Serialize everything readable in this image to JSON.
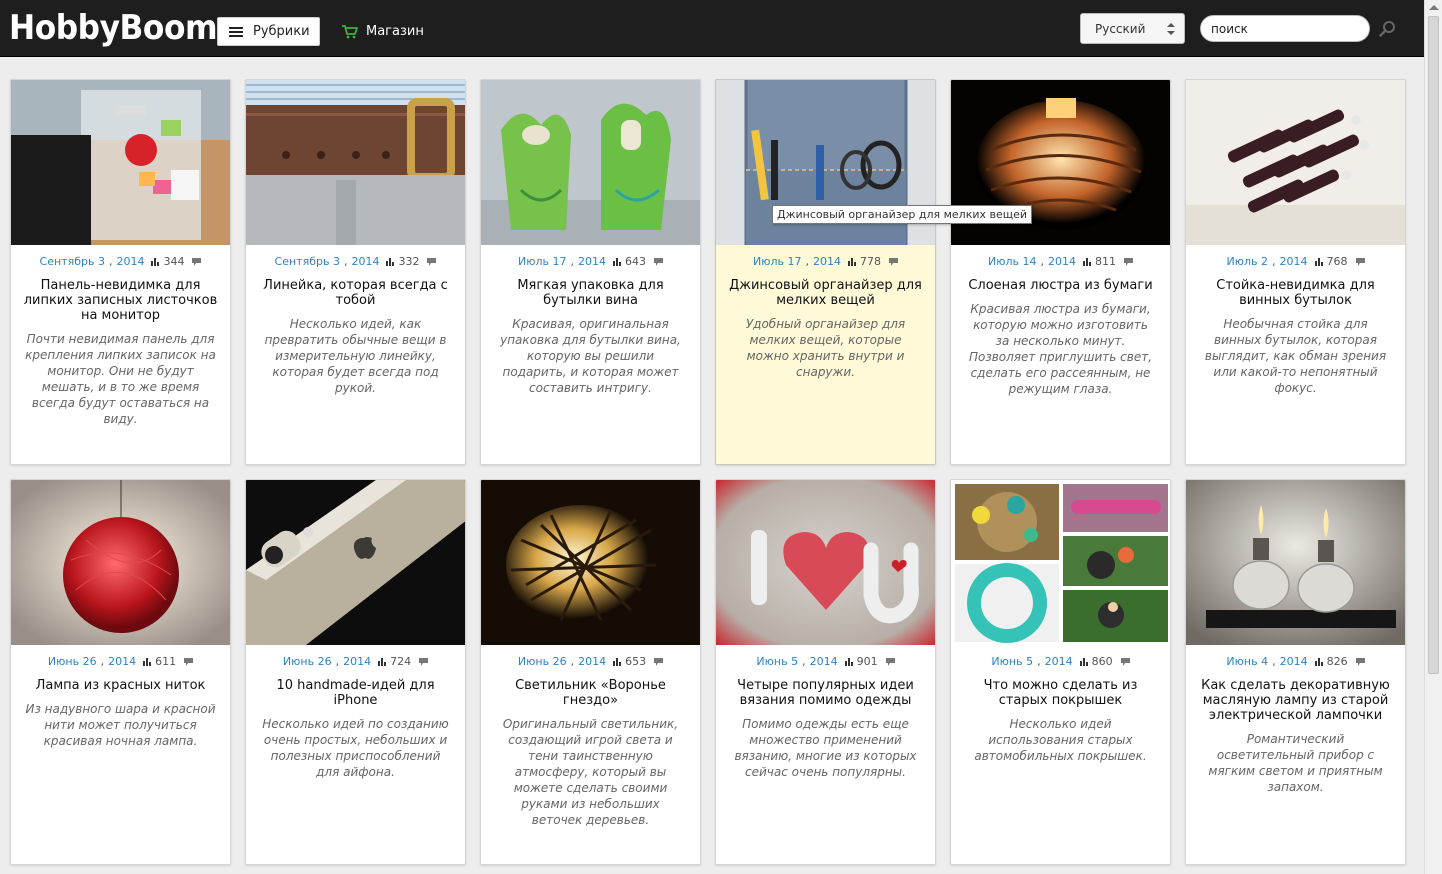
{
  "header": {
    "logo": "HobbyBoom",
    "rubrics_label": "Рубрики",
    "shop_label": "Магазин",
    "language": "Русский",
    "search_value": "поиск"
  },
  "tooltip": "Джинсовый органайзер для мелких вещей",
  "cards": [
    {
      "date": "Сентябрь 3",
      "year": "2014",
      "views": "344",
      "title": "Панель-невидимка для липких записных листочков на монитор",
      "desc": "Почти невидимая панель для крепления липких записок на монитор. Они не будут мешать, и в то же время всегда будут оставаться на виду."
    },
    {
      "date": "Сентябрь 3",
      "year": "2014",
      "views": "332",
      "title": "Линейка, которая всегда с тобой",
      "desc": "Несколько идей, как превратить обычные вещи в измерительную линейку, которая будет всегда под рукой."
    },
    {
      "date": "Июль 17",
      "year": "2014",
      "views": "643",
      "title": "Мягкая упаковка для бутылки вина",
      "desc": "Красивая, оригинальная упаковка для бутылки вина, которую вы решили подарить, и которая может составить интригу."
    },
    {
      "date": "Июль 17",
      "year": "2014",
      "views": "778",
      "title": "Джинсовый органайзер для мелких вещей",
      "desc": "Удобный органайзер для мелких вещей, которые можно хранить внутри и снаружи."
    },
    {
      "date": "Июль 14",
      "year": "2014",
      "views": "811",
      "title": "Слоеная люстра из бумаги",
      "desc": "Красивая люстра из бумаги, которую можно изготовить за несколько минут. Позволяет приглушить свет, сделать его рассеянным, не режущим глаза."
    },
    {
      "date": "Июль 2",
      "year": "2014",
      "views": "768",
      "title": "Стойка-невидимка для винных бутылок",
      "desc": "Необычная стойка для винных бутылок, которая выглядит, как обман зрения или какой-то непонятный фокус."
    },
    {
      "date": "Июнь 26",
      "year": "2014",
      "views": "611",
      "title": "Лампа из красных ниток",
      "desc": "Из надувного шара и красной нити может получиться красивая ночная лампа."
    },
    {
      "date": "Июнь 26",
      "year": "2014",
      "views": "724",
      "title": "10 handmade-идей для iPhone",
      "desc": "Несколько идей по созданию очень простых, небольших и полезных приспособлений для айфона."
    },
    {
      "date": "Июнь 26",
      "year": "2014",
      "views": "653",
      "title": "Светильник «Воронье гнездо»",
      "desc": "Оригинальный светильник, создающий игрой света и тени таинственную атмосферу, который вы можете сделать своими руками из небольших веточек деревьев."
    },
    {
      "date": "Июнь 5",
      "year": "2014",
      "views": "901",
      "title": "Четыре популярных идеи вязания помимо одежды",
      "desc": "Помимо одежды есть еще множество применений вязанию, многие из которых сейчас очень популярны."
    },
    {
      "date": "Июнь 5",
      "year": "2014",
      "views": "860",
      "title": "Что можно сделать из старых покрышек",
      "desc": "Несколько идей использования старых автомобильных покрышек."
    },
    {
      "date": "Июнь 4",
      "year": "2014",
      "views": "826",
      "title": "Как сделать декоративную масляную лампу из старой электрической лампочки",
      "desc": "Романтический осветительный прибор с мягким светом и приятным запахом."
    }
  ]
}
